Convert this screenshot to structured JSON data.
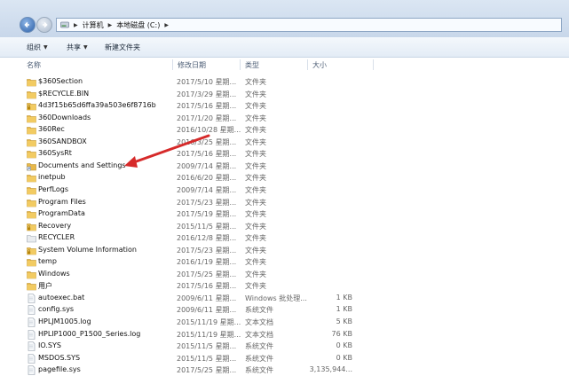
{
  "address": {
    "crumbs": [
      "计算机",
      "本地磁盘 (C:)"
    ],
    "back_icon": "back-arrow-icon",
    "forward_icon": "forward-arrow-icon",
    "drive_icon": "drive-icon"
  },
  "toolbar": {
    "organize": "组织",
    "share": "共享",
    "new_folder": "新建文件夹"
  },
  "columns": {
    "name": "名称",
    "date": "修改日期",
    "type": "类型",
    "size": "大小"
  },
  "rows": [
    {
      "name": "$360Section",
      "date": "2017/5/10 星期...",
      "type": "文件夹",
      "size": "",
      "icon": "folder"
    },
    {
      "name": "$RECYCLE.BIN",
      "date": "2017/3/29 星期...",
      "type": "文件夹",
      "size": "",
      "icon": "folder"
    },
    {
      "name": "4d3f15b65d6ffa39a503e6f8716b",
      "date": "2017/5/16 星期...",
      "type": "文件夹",
      "size": "",
      "icon": "folder-locked"
    },
    {
      "name": "360Downloads",
      "date": "2017/1/20 星期...",
      "type": "文件夹",
      "size": "",
      "icon": "folder"
    },
    {
      "name": "360Rec",
      "date": "2016/10/28 星期...",
      "type": "文件夹",
      "size": "",
      "icon": "folder"
    },
    {
      "name": "360SANDBOX",
      "date": "2016/3/25 星期...",
      "type": "文件夹",
      "size": "",
      "icon": "folder"
    },
    {
      "name": "360SysRt",
      "date": "2017/5/16 星期...",
      "type": "文件夹",
      "size": "",
      "icon": "folder"
    },
    {
      "name": "Documents and Settings",
      "date": "2009/7/14 星期...",
      "type": "文件夹",
      "size": "",
      "icon": "shortcut"
    },
    {
      "name": "inetpub",
      "date": "2016/6/20 星期...",
      "type": "文件夹",
      "size": "",
      "icon": "folder"
    },
    {
      "name": "PerfLogs",
      "date": "2009/7/14 星期...",
      "type": "文件夹",
      "size": "",
      "icon": "folder"
    },
    {
      "name": "Program Files",
      "date": "2017/5/23 星期...",
      "type": "文件夹",
      "size": "",
      "icon": "folder"
    },
    {
      "name": "ProgramData",
      "date": "2017/5/19 星期...",
      "type": "文件夹",
      "size": "",
      "icon": "folder"
    },
    {
      "name": "Recovery",
      "date": "2015/11/5 星期...",
      "type": "文件夹",
      "size": "",
      "icon": "folder-locked"
    },
    {
      "name": "RECYCLER",
      "date": "2016/12/8 星期...",
      "type": "文件夹",
      "size": "",
      "icon": "folder-blank"
    },
    {
      "name": "System Volume Information",
      "date": "2017/5/23 星期...",
      "type": "文件夹",
      "size": "",
      "icon": "folder-locked"
    },
    {
      "name": "temp",
      "date": "2016/1/19 星期...",
      "type": "文件夹",
      "size": "",
      "icon": "folder"
    },
    {
      "name": "Windows",
      "date": "2017/5/25 星期...",
      "type": "文件夹",
      "size": "",
      "icon": "folder"
    },
    {
      "name": "用户",
      "date": "2017/5/16 星期...",
      "type": "文件夹",
      "size": "",
      "icon": "folder"
    },
    {
      "name": "autoexec.bat",
      "date": "2009/6/11 星期...",
      "type": "Windows 批处理...",
      "size": "1 KB",
      "icon": "file"
    },
    {
      "name": "config.sys",
      "date": "2009/6/11 星期...",
      "type": "系统文件",
      "size": "1 KB",
      "icon": "file"
    },
    {
      "name": "HPLJM1005.log",
      "date": "2015/11/19 星期...",
      "type": "文本文档",
      "size": "5 KB",
      "icon": "file"
    },
    {
      "name": "HPLIP1000_P1500_Series.log",
      "date": "2015/11/19 星期...",
      "type": "文本文档",
      "size": "76 KB",
      "icon": "file"
    },
    {
      "name": "IO.SYS",
      "date": "2015/11/5 星期...",
      "type": "系统文件",
      "size": "0 KB",
      "icon": "file"
    },
    {
      "name": "MSDOS.SYS",
      "date": "2015/11/5 星期...",
      "type": "系统文件",
      "size": "0 KB",
      "icon": "file"
    },
    {
      "name": "pagefile.sys",
      "date": "2017/5/25 星期...",
      "type": "系统文件",
      "size": "3,135,944...",
      "icon": "file"
    }
  ],
  "colors": {
    "folder": "#e8b84a",
    "arrow": "#d62a2a",
    "accent": "#2b5fa8"
  }
}
